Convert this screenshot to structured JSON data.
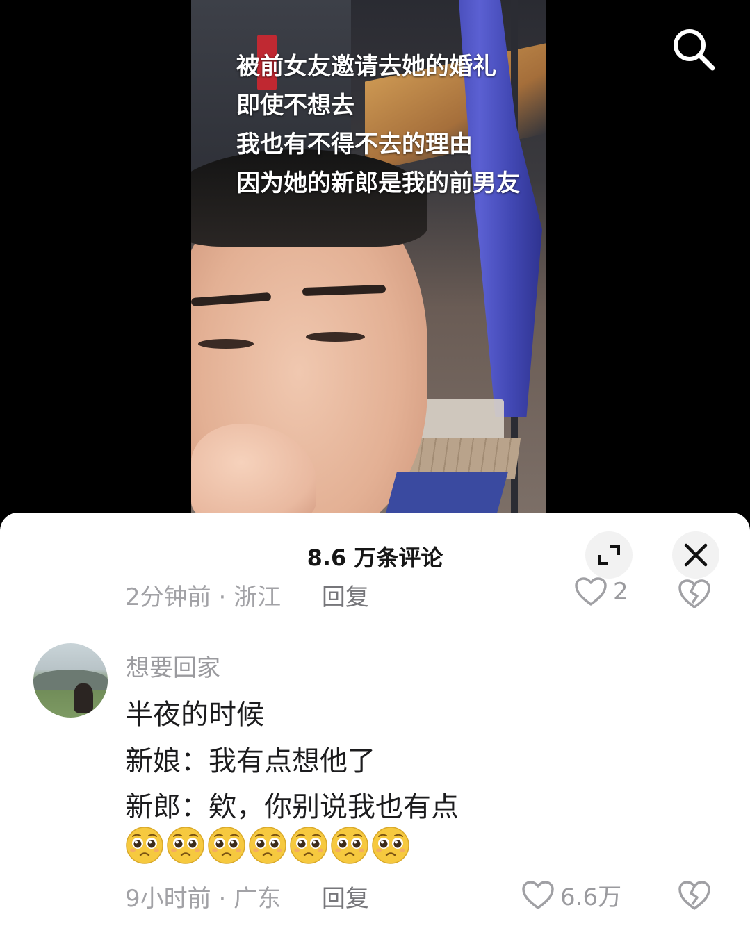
{
  "video": {
    "caption_lines": [
      "被前女友邀请去她的婚礼",
      "即使不想去",
      "我也有不得不去的理由",
      "因为她的新郎是我的前男友"
    ]
  },
  "icons": {
    "search": "search-icon",
    "expand": "expand-icon",
    "close": "close-icon",
    "like": "heart-outline-icon",
    "dislike": "broken-heart-icon",
    "emoji": "pleading-face-emoji"
  },
  "comments_panel": {
    "title": "8.6 万条评论"
  },
  "partial_comment": {
    "time": "2分钟前",
    "location": "浙江",
    "reply_label": "回复",
    "likes": "2"
  },
  "comment": {
    "username": "想要回家",
    "lines": [
      "半夜的时候",
      "新娘：我有点想他了",
      "新郎：欸，你别说我也有点"
    ],
    "emoji_count": 7,
    "time": "9小时前",
    "location": "广东",
    "reply_label": "回复",
    "likes": "6.6万"
  },
  "colors": {
    "emoji_yellow": "#f6c93f",
    "icon_gray": "#a0a0a4",
    "meta_gray": "#a2a2a6"
  }
}
